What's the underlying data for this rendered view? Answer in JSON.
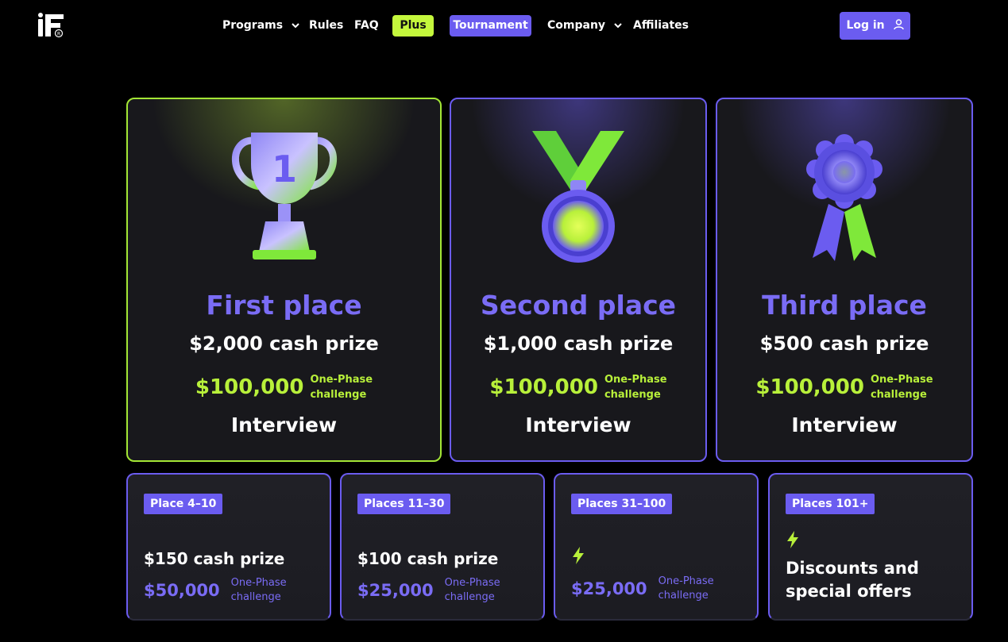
{
  "nav": {
    "programs": "Programs",
    "rules": "Rules",
    "faq": "FAQ",
    "plus": "Plus",
    "tournament": "Tournament",
    "company": "Company",
    "affiliates": "Affiliates",
    "login": "Log in"
  },
  "colors": {
    "accent_purple": "#6b5cf0",
    "accent_lime": "#b8f03a",
    "background": "#000000",
    "card": "#18181c"
  },
  "top_cards": [
    {
      "icon": "trophy-icon",
      "title": "First place",
      "cash": "$2,000 cash prize",
      "challenge_amount": "$100,000",
      "challenge_line1": "One-Phase",
      "challenge_line2": "challenge",
      "extra": "Interview"
    },
    {
      "icon": "medal-icon",
      "title": "Second place",
      "cash": "$1,000 cash prize",
      "challenge_amount": "$100,000",
      "challenge_line1": "One-Phase",
      "challenge_line2": "challenge",
      "extra": "Interview"
    },
    {
      "icon": "rosette-icon",
      "title": "Third place",
      "cash": "$500 cash prize",
      "challenge_amount": "$100,000",
      "challenge_line1": "One-Phase",
      "challenge_line2": "challenge",
      "extra": "Interview"
    }
  ],
  "bottom_cards": [
    {
      "tag": "Place 4–10",
      "cash": "$150 cash prize",
      "challenge_amount": "$50,000",
      "challenge_line1": "One-Phase",
      "challenge_line2": "challenge"
    },
    {
      "tag": "Places 11–30",
      "cash": "$100 cash prize",
      "challenge_amount": "$25,000",
      "challenge_line1": "One-Phase",
      "challenge_line2": "challenge"
    },
    {
      "tag": "Places 31–100",
      "icon": "lightning-icon",
      "challenge_amount": "$25,000",
      "challenge_line1": "One-Phase",
      "challenge_line2": "challenge"
    },
    {
      "tag": "Places 101+",
      "icon": "lightning-icon",
      "text_line1": "Discounts and",
      "text_line2": "special offers"
    }
  ]
}
